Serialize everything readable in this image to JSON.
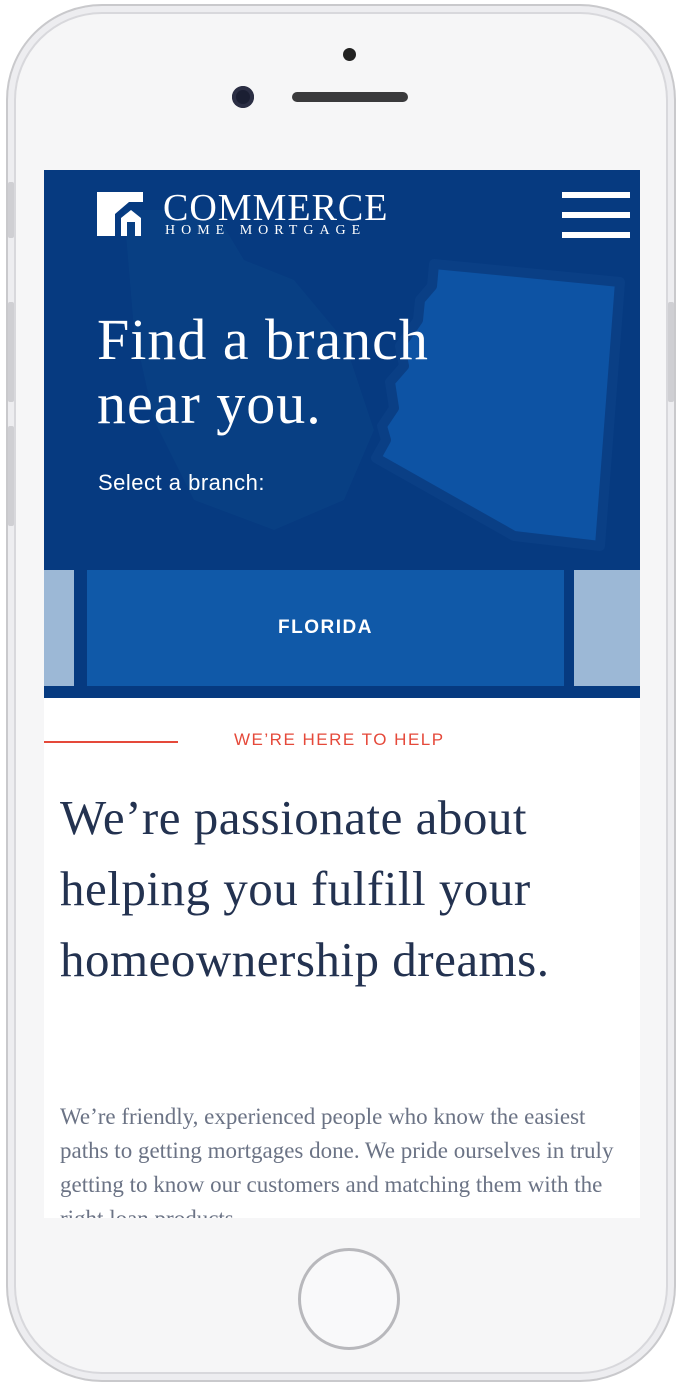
{
  "device": {
    "type": "iPhone",
    "frame_color": "#f6f6f7"
  },
  "brand": {
    "name": "COMMERCE",
    "tagline": "HOME MORTGAGE",
    "logo_icon": "house-mark-icon",
    "menu_icon": "hamburger-menu-icon"
  },
  "hero": {
    "title": "Find a branch near you.",
    "subtitle": "Select a branch:",
    "background_color": "#063a80",
    "map_icon": "arizona-state-shape-icon"
  },
  "branch_carousel": {
    "selected": "FLORIDA",
    "card_color": "#1059a8",
    "peek_color": "#9cb8d6"
  },
  "intro": {
    "eyebrow": "WE’RE HERE TO HELP",
    "headline": "We’re  passionate about helping you fulfill your homeownership dreams.",
    "body": "We’re friendly, experienced people who know the easiest paths to getting mortgages done. We pride ourselves in truly getting to know our customers and matching them with the right loan products",
    "accent_color": "#e5493a",
    "headline_color": "#233250"
  }
}
